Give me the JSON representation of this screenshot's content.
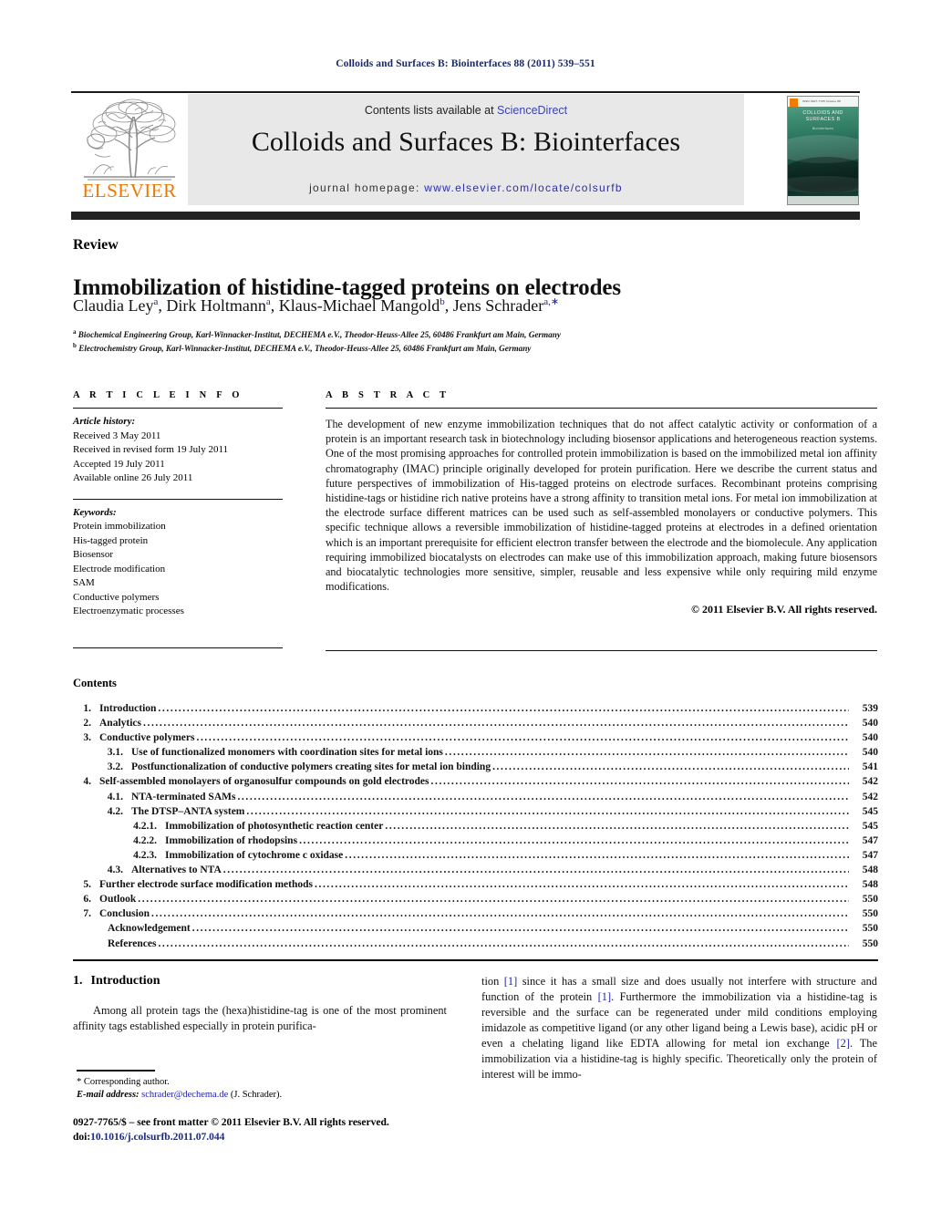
{
  "running_head": "Colloids and Surfaces B: Biointerfaces 88 (2011) 539–551",
  "header": {
    "contents_lists_prefix": "Contents lists available at ",
    "sciencedirect": "ScienceDirect",
    "journal_title": "Colloids and Surfaces B: Biointerfaces",
    "homepage_prefix": "journal homepage: ",
    "homepage_url": "www.elsevier.com/locate/colsurfb",
    "publisher_wordmark": "ELSEVIER",
    "cover": {
      "top_strip": "ISSN 0927-7765     Volume 88",
      "title_line1": "COLLOIDS AND",
      "title_line2": "SURFACES B",
      "subtitle": "Biointerfaces"
    },
    "accent_orange": "#eb7900",
    "link_blue": "#3a43b7"
  },
  "article": {
    "kind": "Review",
    "title": "Immobilization of histidine-tagged proteins on electrodes",
    "authors": "Claudia Ley, Dirk Holtmann, Klaus-Michael Mangold, Jens Schrader",
    "author_parts": [
      {
        "name": "Claudia Ley",
        "sup": "a",
        "sep": ", "
      },
      {
        "name": "Dirk Holtmann",
        "sup": "a",
        "sep": ", "
      },
      {
        "name": "Klaus-Michael Mangold",
        "sup": "b",
        "sep": ", "
      },
      {
        "name": "Jens Schrader",
        "sup": "a,∗",
        "sep": ""
      }
    ],
    "affiliation_a": "Biochemical Engineering Group, Karl-Winnacker-Institut, DECHEMA e.V., Theodor-Heuss-Allee 25, 60486 Frankfurt am Main, Germany",
    "affiliation_a_sup": "a",
    "affiliation_b": "Electrochemistry Group, Karl-Winnacker-Institut, DECHEMA e.V., Theodor-Heuss-Allee 25, 60486 Frankfurt am Main, Germany",
    "affiliation_b_sup": "b"
  },
  "article_info": {
    "heading": "A R T I C L E  I N F O",
    "history_label": "Article history:",
    "history": [
      "Received 3 May 2011",
      "Received in revised form 19 July 2011",
      "Accepted 19 July 2011",
      "Available online 26 July 2011"
    ],
    "keywords_label": "Keywords:",
    "keywords": [
      "Protein immobilization",
      "His-tagged protein",
      "Biosensor",
      "Electrode modification",
      "SAM",
      "Conductive polymers",
      "Electroenzymatic processes"
    ]
  },
  "abstract": {
    "heading": "A B S T R A C T",
    "text": "The development of new enzyme immobilization techniques that do not affect catalytic activity or conformation of a protein is an important research task in biotechnology including biosensor applications and heterogeneous reaction systems. One of the most promising approaches for controlled protein immobilization is based on the immobilized metal ion affinity chromatography (IMAC) principle originally developed for protein purification. Here we describe the current status and future perspectives of immobilization of His-tagged proteins on electrode surfaces. Recombinant proteins comprising histidine-tags or histidine rich native proteins have a strong affinity to transition metal ions. For metal ion immobilization at the electrode surface different matrices can be used such as self-assembled monolayers or conductive polymers. This specific technique allows a reversible immobilization of histidine-tagged proteins at electrodes in a defined orientation which is an important prerequisite for efficient electron transfer between the electrode and the biomolecule. Any application requiring immobilized biocatalysts on electrodes can make use of this immobilization approach, making future biosensors and biocatalytic technologies more sensitive, simpler, reusable and less expensive while only requiring mild enzyme modifications.",
    "copyright": "© 2011 Elsevier B.V. All rights reserved."
  },
  "contents": {
    "heading": "Contents",
    "rows": [
      {
        "level": 1,
        "num": "1.",
        "label": "Introduction",
        "page": "539"
      },
      {
        "level": 1,
        "num": "2.",
        "label": "Analytics",
        "page": "540"
      },
      {
        "level": 1,
        "num": "3.",
        "label": "Conductive polymers",
        "page": "540"
      },
      {
        "level": 2,
        "num": "3.1.",
        "label": "Use of functionalized monomers with coordination sites for metal ions",
        "page": "540"
      },
      {
        "level": 2,
        "num": "3.2.",
        "label": "Postfunctionalization of conductive polymers creating sites for metal ion binding",
        "page": "541"
      },
      {
        "level": 1,
        "num": "4.",
        "label": "Self-assembled monolayers of organosulfur compounds on gold electrodes",
        "page": "542"
      },
      {
        "level": 2,
        "num": "4.1.",
        "label": "NTA-terminated SAMs",
        "page": "542"
      },
      {
        "level": 2,
        "num": "4.2.",
        "label": "The DTSP–ANTA system",
        "page": "545"
      },
      {
        "level": 3,
        "num": "4.2.1.",
        "label": "Immobilization of photosynthetic reaction center",
        "page": "545"
      },
      {
        "level": 3,
        "num": "4.2.2.",
        "label": "Immobilization of rhodopsins",
        "page": "547"
      },
      {
        "level": 3,
        "num": "4.2.3.",
        "label": "Immobilization of cytochrome c oxidase",
        "page": "547"
      },
      {
        "level": 2,
        "num": "4.3.",
        "label": "Alternatives to NTA",
        "page": "548"
      },
      {
        "level": 1,
        "num": "5.",
        "label": "Further electrode surface modification methods",
        "page": "548"
      },
      {
        "level": 1,
        "num": "6.",
        "label": "Outlook",
        "page": "550"
      },
      {
        "level": 1,
        "num": "7.",
        "label": "Conclusion",
        "page": "550"
      },
      {
        "level": 0,
        "num": "",
        "label": "Acknowledgement",
        "page": "550"
      },
      {
        "level": 0,
        "num": "",
        "label": "References",
        "page": "550"
      }
    ]
  },
  "introduction": {
    "number": "1.",
    "heading": "Introduction",
    "col_left": "Among all protein tags the (hexa)histidine-tag is one of the most prominent affinity tags established especially in protein purifica-",
    "col_right_pre1": "tion ",
    "col_right_ref1": "[1]",
    "col_right_mid1": " since it has a small size and does usually not interfere with structure and function of the protein ",
    "col_right_ref2": "[1]",
    "col_right_mid2": ". Furthermore the immobilization via a histidine-tag is reversible and the surface can be regenerated under mild conditions employing imidazole as competitive ligand (or any other ligand being a Lewis base), acidic pH or even a chelating ligand like EDTA allowing for metal ion exchange ",
    "col_right_ref3": "[2]",
    "col_right_end": ". The immobilization via a histidine-tag is highly specific. Theoretically only the protein of interest will be immo-"
  },
  "footnotes": {
    "corresponding": "* Corresponding author.",
    "email_label": "E-mail address:",
    "email": "schrader@dechema.de",
    "email_suffix": " (J. Schrader)."
  },
  "imprint": {
    "line1": "0927-7765/$ – see front matter © 2011 Elsevier B.V. All rights reserved.",
    "doi_label": "doi:",
    "doi": "10.1016/j.colsurfb.2011.07.044"
  }
}
